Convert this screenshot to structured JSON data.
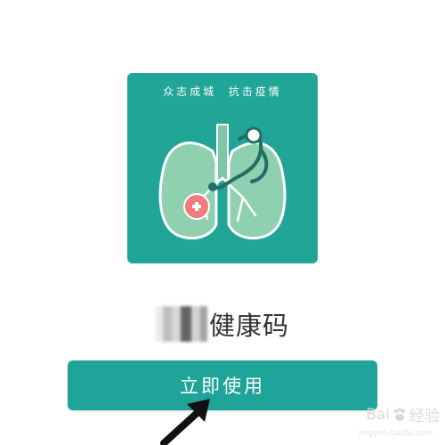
{
  "banner": {
    "slogan": "众志成城  抗击疫情",
    "illustration_icon": "lungs-with-stethoscope-icon",
    "badge_icon": "plus-icon"
  },
  "app": {
    "title": "健康码"
  },
  "button": {
    "label": "立即使用"
  },
  "watermark": {
    "text_left": "Bai",
    "text_right": "经验",
    "sub": "jingyan.baidu.com"
  },
  "colors": {
    "banner_bg": "#21a597",
    "button_bg": "#1ea498",
    "lung_fill": "#8fd0b0",
    "badge": "#f07c7c"
  }
}
